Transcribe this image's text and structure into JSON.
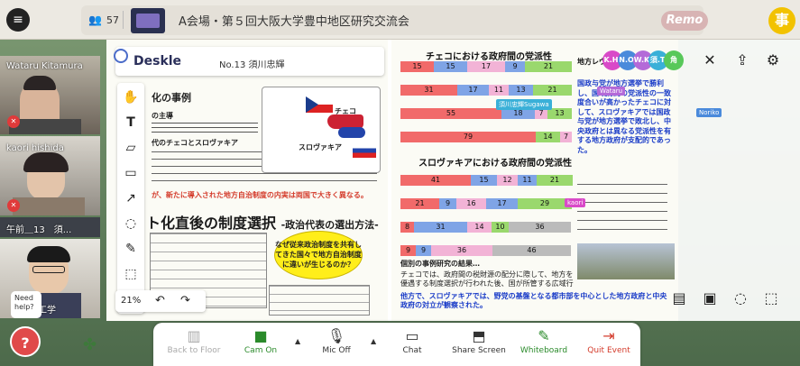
{
  "topbar": {
    "participant_count": "57",
    "room_title": "A会場・第５回大阪大学豊中地区研究交流会",
    "brand": "Remo",
    "user_avatar_initial": "事"
  },
  "videos": [
    {
      "name": "Wataru Kitamura"
    },
    {
      "name": "kaori hishida"
    },
    {
      "name": "午前＿13　須..."
    },
    {
      "name": "工学"
    }
  ],
  "whiteboard": {
    "app_name": "Deskle",
    "doc_number": "No.13 須川忠輝",
    "zoom_level": "21%",
    "left": {
      "section_title": "ト化直後の制度選択",
      "section_subtitle": "-政治代表の選出方法-",
      "callout": "なぜ従来政治制度を共有してきた国々で地方自治制度に違いが生じるのか？",
      "map_label_czech": "チェコ",
      "map_label_slovakia": "スロヴァキア",
      "heading_small": "化の事例",
      "heading_a": "の主導",
      "heading_b": "代のチェコとスロヴァキア",
      "red_line": "が、新たに導入された地方自治制度の内実は両国で大きく異なる。"
    },
    "right": {
      "chart1_title": "チェコにおける政府間の党派性",
      "chart2_title": "スロヴァキアにおける政府間の党派性",
      "chart1_rows": [
        [
          {
            "v": "15",
            "c": "#f16a6a"
          },
          {
            "v": "15",
            "c": "#7fa4e6"
          },
          {
            "v": "17",
            "c": "#f2b3d6"
          },
          {
            "v": "9",
            "c": "#7fa4e6"
          },
          {
            "v": "21",
            "c": "#9ad86d"
          }
        ],
        [
          {
            "v": "31",
            "c": "#f16a6a"
          },
          {
            "v": "17",
            "c": "#7fa4e6"
          },
          {
            "v": "11",
            "c": "#f2b3d6"
          },
          {
            "v": "13",
            "c": "#7fa4e6"
          },
          {
            "v": "21",
            "c": "#9ad86d"
          }
        ],
        [
          {
            "v": "55",
            "c": "#f16a6a"
          },
          {
            "v": "18",
            "c": "#7fa4e6"
          },
          {
            "v": "7",
            "c": "#f2b3d6"
          },
          {
            "v": "13",
            "c": "#9ad86d"
          }
        ],
        [
          {
            "v": "79",
            "c": "#f16a6a"
          },
          {
            "v": "14",
            "c": "#9ad86d"
          },
          {
            "v": "7",
            "c": "#f2b3d6"
          }
        ]
      ],
      "chart2_rows": [
        [
          {
            "v": "41",
            "c": "#f16a6a"
          },
          {
            "v": "15",
            "c": "#7fa4e6"
          },
          {
            "v": "12",
            "c": "#f2b3d6"
          },
          {
            "v": "11",
            "c": "#7fa4e6"
          },
          {
            "v": "21",
            "c": "#9ad86d"
          }
        ],
        [
          {
            "v": "21",
            "c": "#f16a6a"
          },
          {
            "v": "9",
            "c": "#7fa4e6"
          },
          {
            "v": "16",
            "c": "#f2b3d6"
          },
          {
            "v": "17",
            "c": "#7fa4e6"
          },
          {
            "v": "29",
            "c": "#9ad86d"
          }
        ],
        [
          {
            "v": "8",
            "c": "#f16a6a"
          },
          {
            "v": "31",
            "c": "#7fa4e6"
          },
          {
            "v": "14",
            "c": "#f2b3d6"
          },
          {
            "v": "10",
            "c": "#9ad86d"
          },
          {
            "v": "36",
            "c": "#bbb"
          }
        ],
        [
          {
            "v": "9",
            "c": "#f16a6a"
          },
          {
            "v": "9",
            "c": "#7fa4e6"
          },
          {
            "v": "36",
            "c": "#f2b3d6"
          },
          {
            "v": "46",
            "c": "#bbb"
          }
        ]
      ],
      "side_heading": "地方レヴェルの政治状況",
      "side_text": "国政与党が地方選挙で勝利し、国政府間の党派性の一致度合いが高かったチェコに対して、スロヴァキアでは国政与党が地方選挙で敗北し、中央政府とは異なる党派性を有する地方政府が支配的であった。",
      "bottom_heading": "個別の事例研究の結果…",
      "bottom_text": "チェコでは、政府間の税財源の配分に際して、地方を優遇する制度選択が行われた後、国が所管する広域行政や補助金の分配に地方政府が関与できる仕組みが整えられていた。",
      "bottom_text_blue": "他方で、スロヴァキアでは、野党の基盤となる都市部を中心とした地方政府と中央政府の対立が観察された。"
    }
  },
  "cursors": [
    "Wataru",
    "須川忠輝Sugawa",
    "kaori",
    "Noriko"
  ],
  "avatars": [
    {
      "label": "K.H.",
      "color": "#d94ac8"
    },
    {
      "label": "N.O.",
      "color": "#4a8adb"
    },
    {
      "label": "W.K.",
      "color": "#b46ad8"
    },
    {
      "label": "須.T.",
      "color": "#3ab0d8"
    },
    {
      "label": "角",
      "color": "#58c85a"
    }
  ],
  "bottombar": {
    "back_to_floor": "Back to Floor",
    "cam_on": "Cam On",
    "mic_off": "Mic Off",
    "chat": "Chat",
    "share_screen": "Share Screen",
    "whiteboard": "Whiteboard",
    "quit_event": "Quit Event"
  },
  "help": {
    "bubble": "Need help?"
  }
}
